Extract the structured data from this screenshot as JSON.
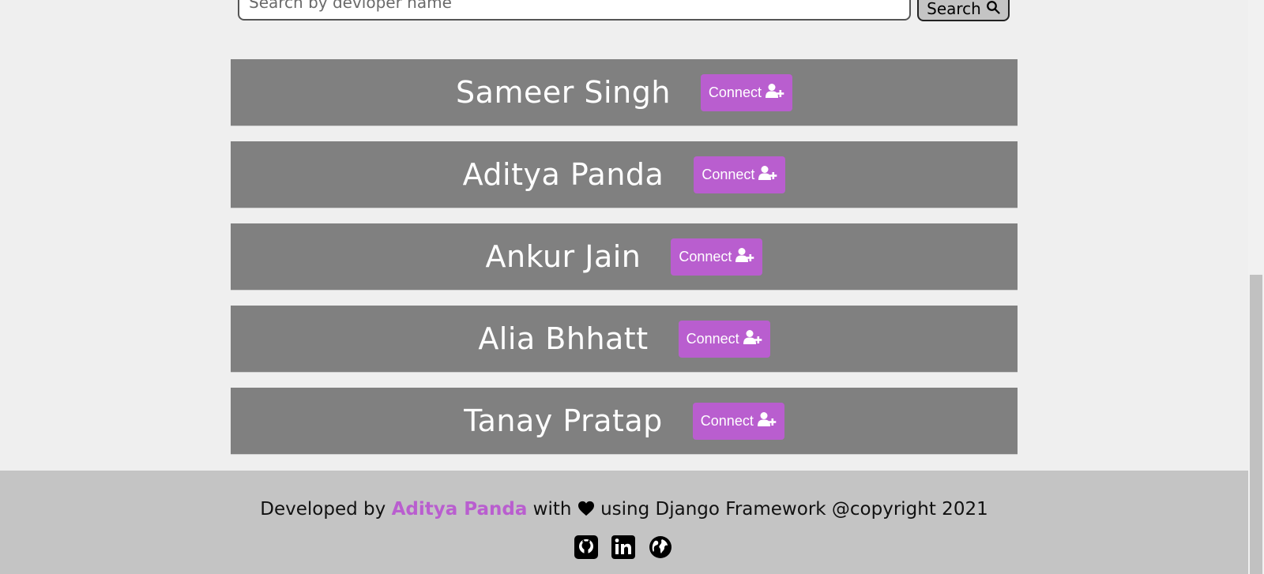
{
  "search": {
    "placeholder": "Search by devloper name",
    "button_label": "Search"
  },
  "developers": [
    {
      "name": "Sameer Singh",
      "action": "Connect"
    },
    {
      "name": "Aditya Panda",
      "action": "Connect"
    },
    {
      "name": "Ankur Jain",
      "action": "Connect"
    },
    {
      "name": "Alia Bhhatt",
      "action": "Connect"
    },
    {
      "name": "Tanay Pratap",
      "action": "Connect"
    }
  ],
  "footer": {
    "prefix": "Developed by",
    "author": "Aditya Panda",
    "middle": "with",
    "suffix": "using Django Framework @copyright 2021",
    "icons": [
      "github-icon",
      "linkedin-icon",
      "globe-icon"
    ]
  },
  "colors": {
    "accent": "#b95ecf",
    "card_background": "#808080",
    "footer_background": "#c4c4c4",
    "page_background": "#efefef"
  }
}
